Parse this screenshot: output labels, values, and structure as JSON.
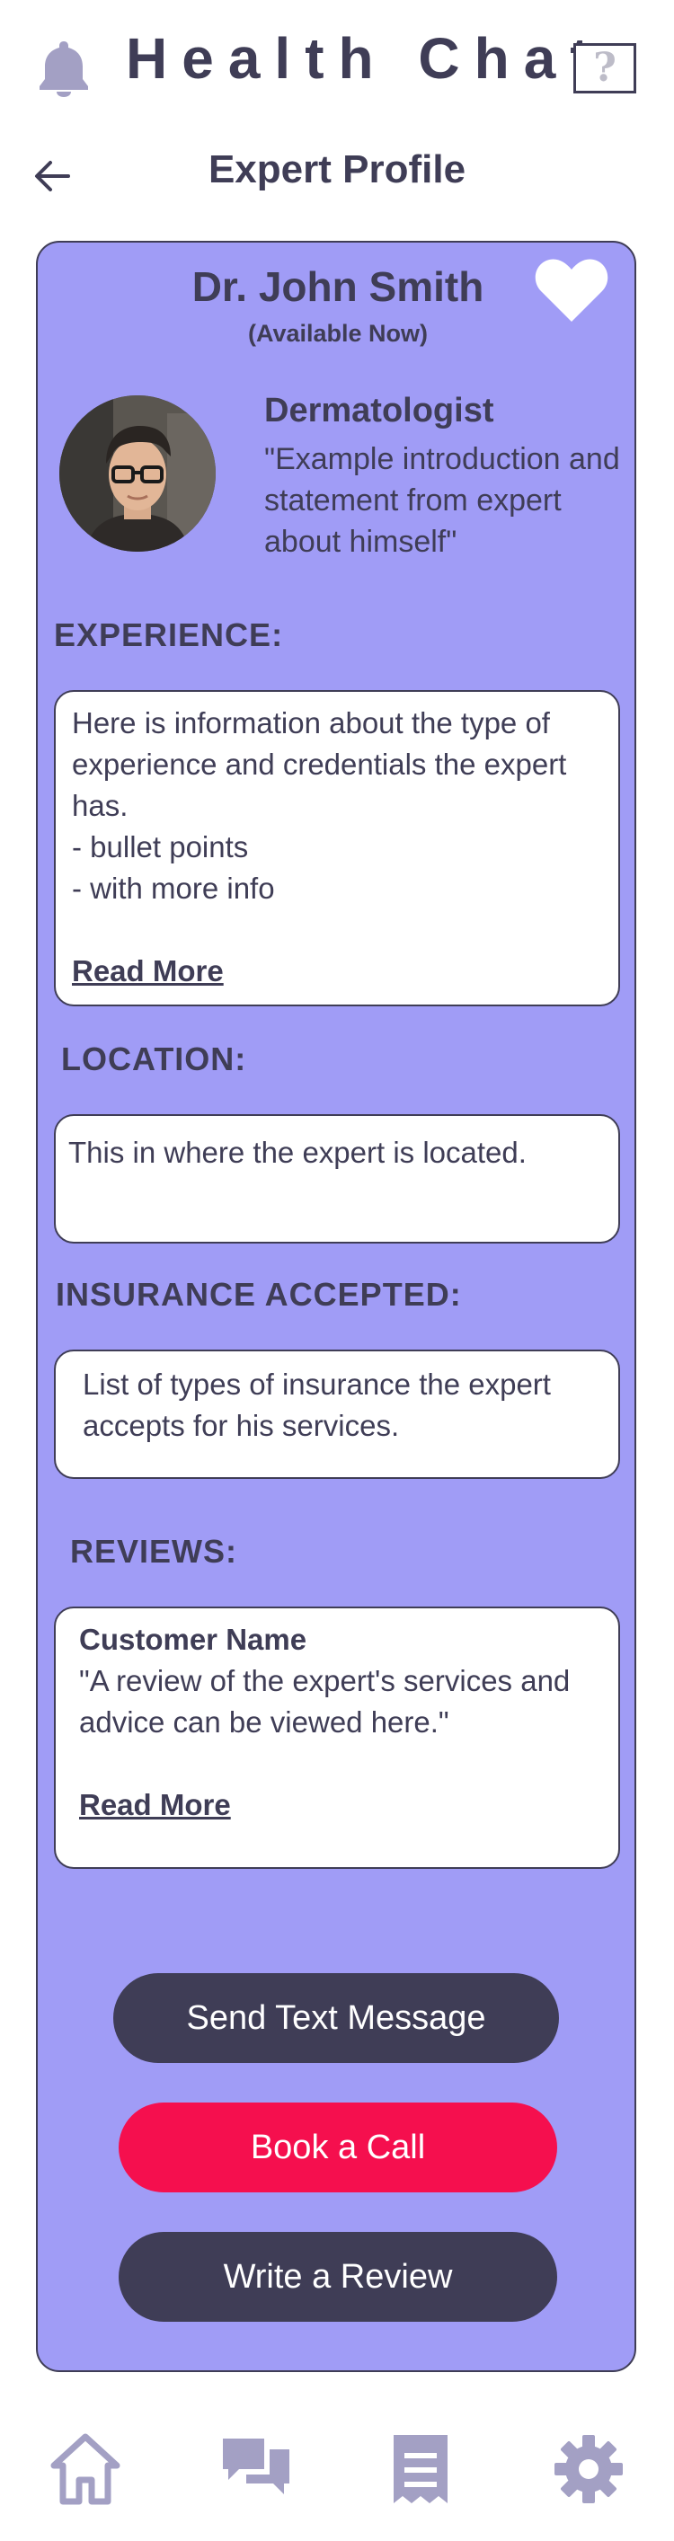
{
  "app": {
    "title": "Health Chat",
    "help_label": "?",
    "icons": {
      "notifications": "bell-icon",
      "help": "question-icon"
    }
  },
  "header": {
    "back_icon": "arrow-left-icon",
    "title": "Expert Profile"
  },
  "profile": {
    "name": "Dr. John Smith",
    "availability": "(Available Now)",
    "favorite_icon": "heart-icon",
    "specialty": "Dermatologist",
    "intro": "\"Example introduction and statement from expert about himself\""
  },
  "experience": {
    "heading": "EXPERIENCE:",
    "lines": [
      "Here is information about the type of",
      "experience and credentials the expert",
      "has.",
      "- bullet points",
      "- with more info"
    ],
    "read_more": "Read More"
  },
  "location": {
    "heading": "LOCATION:",
    "text": "This in where the expert is located."
  },
  "insurance": {
    "heading": "INSURANCE ACCEPTED:",
    "lines": [
      "List of types of insurance the expert",
      "accepts for his services."
    ]
  },
  "reviews": {
    "heading": "REVIEWS:",
    "customer_name": "Customer Name",
    "lines": [
      "\"A review of the expert's services and",
      "advice can be viewed here.\""
    ],
    "read_more": "Read More"
  },
  "actions": {
    "send_text": "Send Text Message",
    "book_call": "Book a Call",
    "write_review": "Write a Review"
  },
  "bottom_nav": {
    "items": [
      "home-icon",
      "chat-icon",
      "receipt-icon",
      "gear-icon"
    ]
  },
  "colors": {
    "primary_dark": "#3f3d56",
    "card_bg": "#a09cf6",
    "accent_red": "#f50f4e",
    "icon_muted": "#a3a0c4"
  }
}
